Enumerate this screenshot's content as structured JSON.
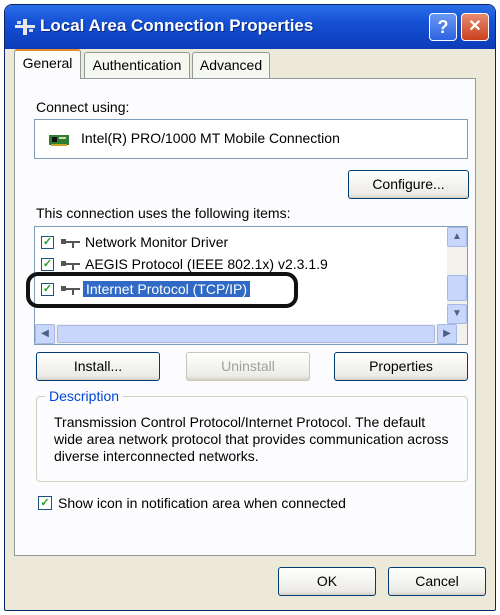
{
  "window": {
    "title": "Local Area Connection Properties",
    "help_glyph": "?",
    "close_glyph": "✕"
  },
  "tabs": [
    {
      "label": "General"
    },
    {
      "label": "Authentication"
    },
    {
      "label": "Advanced"
    }
  ],
  "general": {
    "connect_using_label": "Connect using:",
    "adapter_name": "Intel(R) PRO/1000 MT Mobile Connection",
    "configure_button": "Configure...",
    "items_label": "This connection uses the following items:",
    "items": [
      {
        "label": "Network Monitor Driver",
        "checked": true
      },
      {
        "label": "AEGIS Protocol (IEEE 802.1x) v2.3.1.9",
        "checked": true
      },
      {
        "label": "Internet Protocol (TCP/IP)",
        "checked": true
      }
    ],
    "install_button": "Install...",
    "uninstall_button": "Uninstall",
    "properties_button": "Properties",
    "description_title": "Description",
    "description_text": "Transmission Control Protocol/Internet Protocol. The default wide area network protocol that provides communication across diverse interconnected networks.",
    "notify_label": "Show icon in notification area when connected",
    "notify_checked": true
  },
  "footer": {
    "ok_button": "OK",
    "cancel_button": "Cancel"
  },
  "colors": {
    "titlebar": "#0c3cb8",
    "selection": "#316ac5",
    "dialog_bg": "#ece9d8"
  },
  "icons": {
    "title": "network-connection-icon",
    "adapter": "network-card-icon",
    "protocol": "network-protocol-icon"
  }
}
